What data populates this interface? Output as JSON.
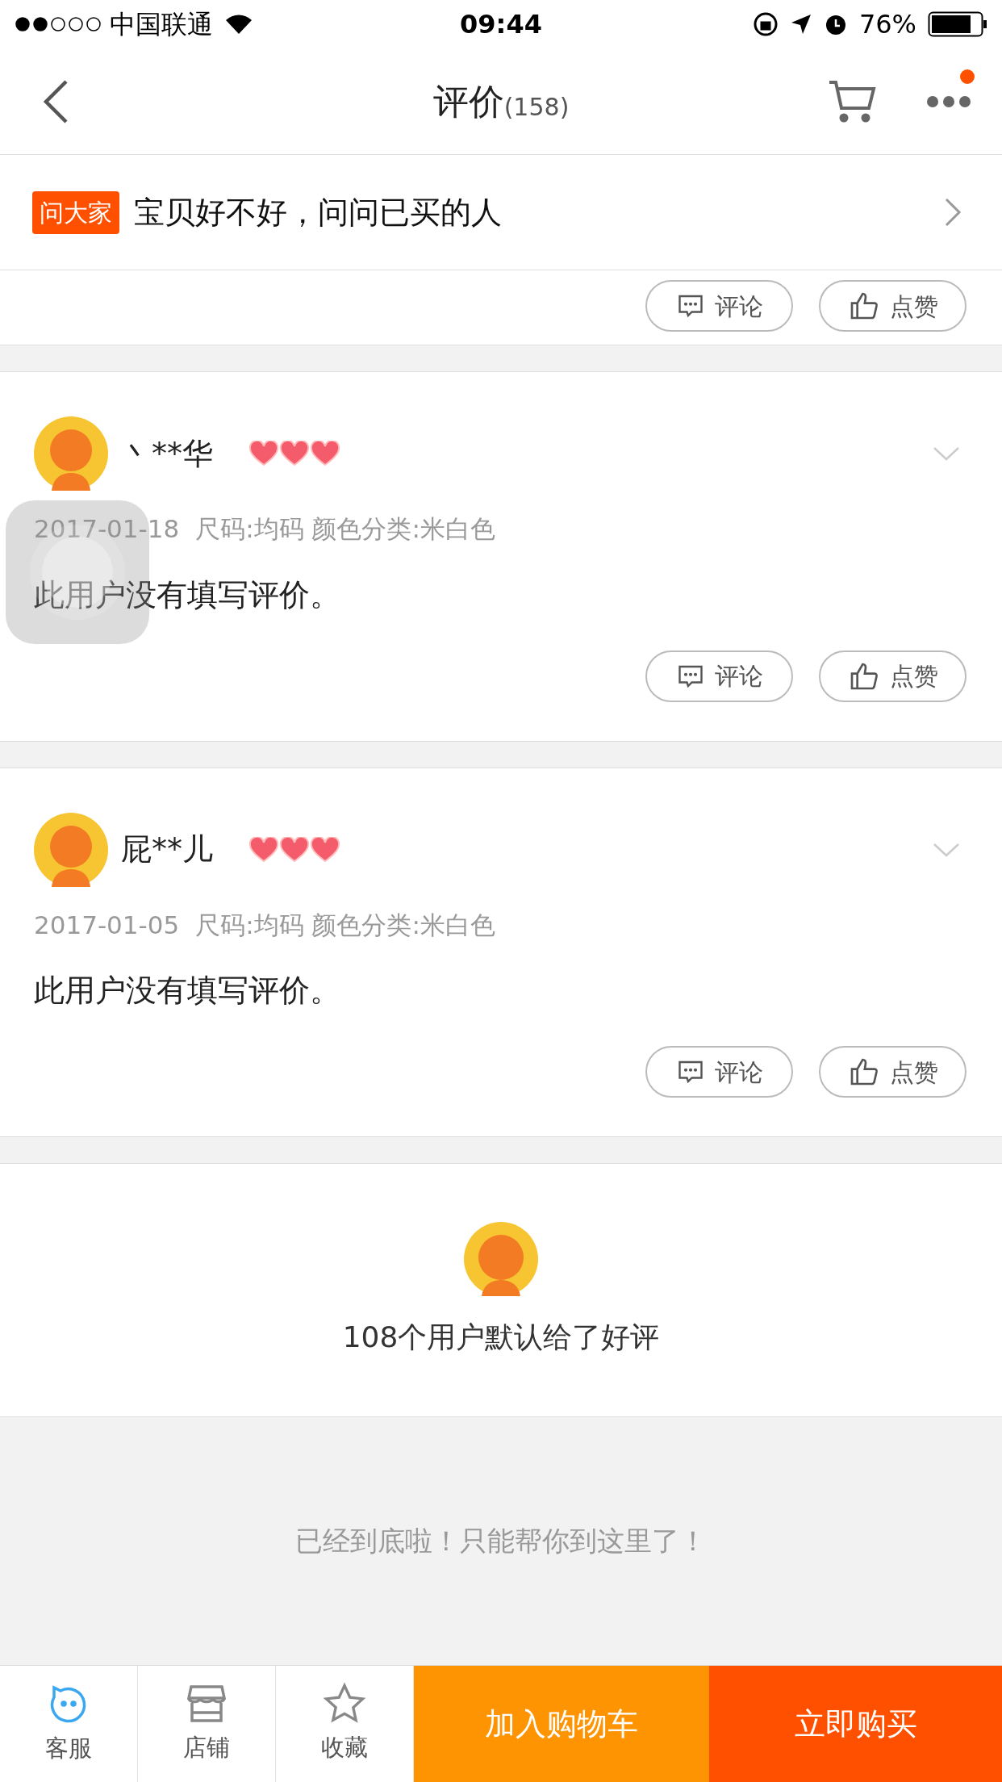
{
  "status_bar": {
    "carrier": "中国联通",
    "time": "09:44",
    "battery": "76%"
  },
  "nav": {
    "title": "评价",
    "count": "(158)",
    "menu_badge": true
  },
  "ask_bar": {
    "tag": "问大家",
    "text": "宝贝好不好，问问已买的人"
  },
  "partial_review": {
    "buttons": [
      {
        "label": "评论",
        "kind": "comment"
      },
      {
        "label": "点赞",
        "kind": "like"
      }
    ]
  },
  "reviews": [
    {
      "user": "丶**华",
      "stars": 3,
      "date": "2017-01-18",
      "sku": "尺码:均码 颜色分类:米白色",
      "text": "此用户没有填写评价。",
      "buttons": [
        {
          "label": "评论",
          "kind": "comment"
        },
        {
          "label": "点赞",
          "kind": "like"
        }
      ]
    },
    {
      "user": "屁**儿",
      "stars": 3,
      "date": "2017-01-05",
      "sku": "尺码:均码 颜色分类:米白色",
      "text": "此用户没有填写评价。",
      "buttons": [
        {
          "label": "评论",
          "kind": "comment"
        },
        {
          "label": "点赞",
          "kind": "like"
        }
      ]
    }
  ],
  "default_praise": {
    "text": "108个用户默认给了好评"
  },
  "end_note": "已经到底啦！只能帮你到这里了！",
  "tab_bar": {
    "items": [
      {
        "label": "客服",
        "kind": "service"
      },
      {
        "label": "店铺",
        "kind": "shop"
      },
      {
        "label": "收藏",
        "kind": "star"
      }
    ],
    "buttons": [
      {
        "label": "加入购物车",
        "kind": "cart"
      },
      {
        "label": "立即购买",
        "kind": "buy"
      }
    ]
  }
}
